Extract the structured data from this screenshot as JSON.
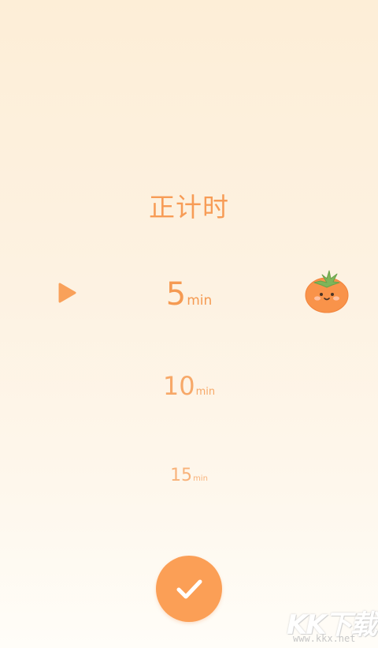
{
  "mode": {
    "title": "正计时"
  },
  "time_options": [
    {
      "value": "5",
      "unit": "min",
      "selected": true
    },
    {
      "value": "10",
      "unit": "min",
      "selected": false
    },
    {
      "value": "15",
      "unit": "min",
      "selected": false
    }
  ],
  "icons": {
    "play": "play-icon",
    "mascot": "tomato-icon",
    "confirm": "checkmark-icon"
  },
  "colors": {
    "accent": "#fb9f56",
    "text_primary": "#f59a52",
    "background_top": "#fdeed7",
    "background_bottom": "#fffdf8"
  },
  "watermark": {
    "logo_text": "KK下载",
    "url": "www.kkx.net"
  }
}
